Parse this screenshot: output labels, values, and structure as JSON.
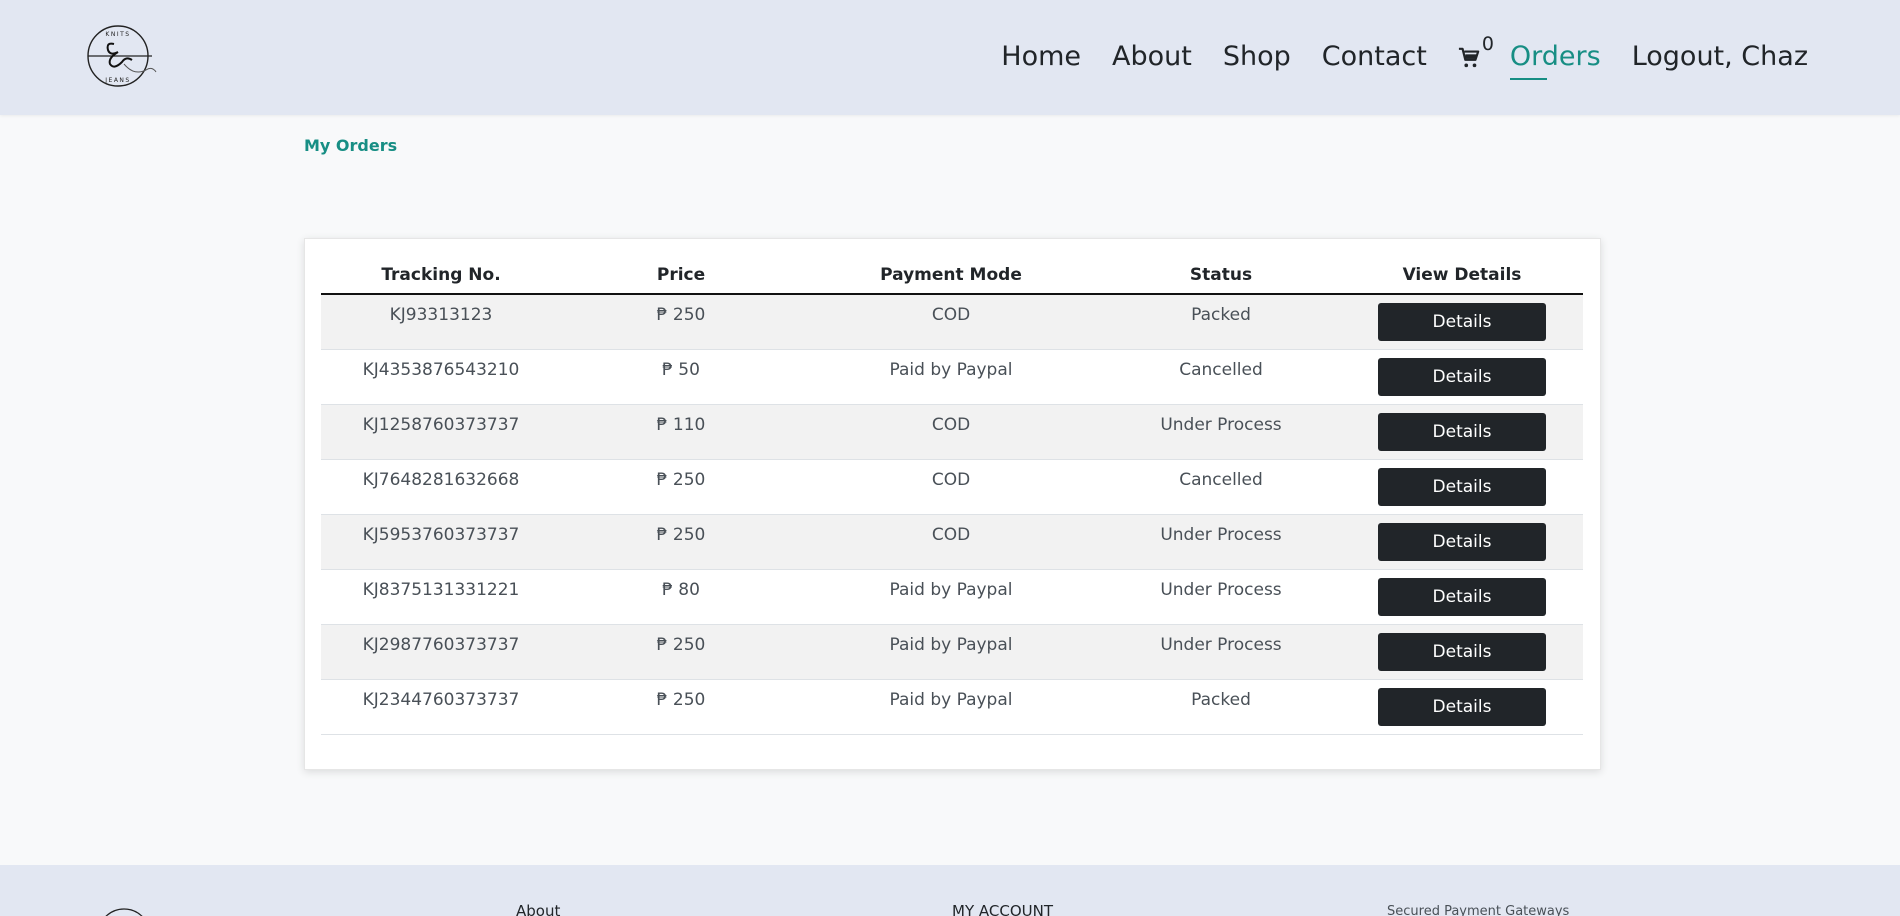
{
  "brand": {
    "logo_text_top": "KNITS",
    "logo_text_bottom": "JEANS"
  },
  "nav": {
    "items": [
      {
        "label": "Home"
      },
      {
        "label": "About"
      },
      {
        "label": "Shop"
      },
      {
        "label": "Contact"
      }
    ],
    "cart_count": "0",
    "orders_label": "Orders",
    "logout_label": "Logout, Chaz"
  },
  "breadcrumb": "My Orders",
  "table": {
    "headers": [
      "Tracking No.",
      "Price",
      "Payment Mode",
      "Status",
      "View Details"
    ],
    "button_label": "Details",
    "rows": [
      {
        "tracking": "KJ93313123",
        "price": "₱ 250",
        "payment": "COD",
        "status": "Packed"
      },
      {
        "tracking": "KJ4353876543210",
        "price": "₱ 50",
        "payment": "Paid by Paypal",
        "status": "Cancelled"
      },
      {
        "tracking": "KJ1258760373737",
        "price": "₱ 110",
        "payment": "COD",
        "status": "Under Process"
      },
      {
        "tracking": "KJ7648281632668",
        "price": "₱ 250",
        "payment": "COD",
        "status": "Cancelled"
      },
      {
        "tracking": "KJ5953760373737",
        "price": "₱ 250",
        "payment": "COD",
        "status": "Under Process"
      },
      {
        "tracking": "KJ8375131331221",
        "price": "₱ 80",
        "payment": "Paid by Paypal",
        "status": "Under Process"
      },
      {
        "tracking": "KJ2987760373737",
        "price": "₱ 250",
        "payment": "Paid by Paypal",
        "status": "Under Process"
      },
      {
        "tracking": "KJ2344760373737",
        "price": "₱ 250",
        "payment": "Paid by Paypal",
        "status": "Packed"
      }
    ]
  },
  "footer": {
    "about_label": "About",
    "account_label": "MY ACCOUNT",
    "payment_label": "Secured Payment Gateways"
  },
  "colors": {
    "accent": "#178e84",
    "header_bg": "#e2e7f2",
    "button_bg": "#212529"
  }
}
